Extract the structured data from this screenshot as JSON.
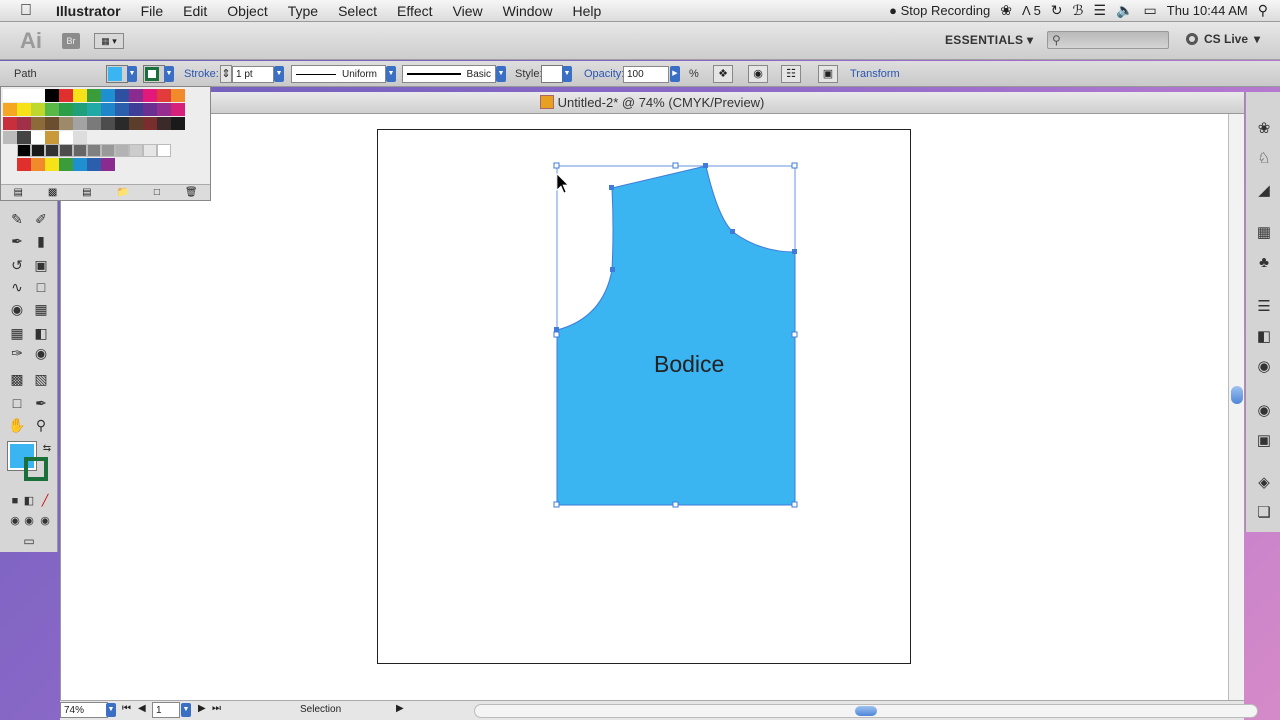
{
  "menubar": {
    "apple": "",
    "items": [
      "Illustrator",
      "File",
      "Edit",
      "Object",
      "Type",
      "Select",
      "Effect",
      "View",
      "Window",
      "Help"
    ],
    "stop_recording": "Stop Recording",
    "adobe_badge": "5",
    "clock": "Thu 10:44 AM"
  },
  "appbar": {
    "logo": "Ai",
    "bridge": "Br",
    "workspace": "ESSENTIALS",
    "cs_live": "CS Live"
  },
  "control": {
    "selection_type": "Path",
    "stroke_label": "Stroke:",
    "stroke_weight": "1 pt",
    "profile": "Uniform",
    "brush": "Basic",
    "style_label": "Style:",
    "opacity_label": "Opacity:",
    "opacity_value": "100",
    "opacity_unit": "%",
    "transform_link": "Transform"
  },
  "document": {
    "title": "Untitled-2* @ 74% (CMYK/Preview)",
    "shape_label": "Bodice",
    "fill_color": "#3bb4f2"
  },
  "status": {
    "zoom": "74%",
    "artboard_number": "1",
    "tool_name": "Selection"
  },
  "colors": {
    "fill": "#3bb4f2",
    "stroke": "#1a6f3a",
    "selection": "#3f7bd8"
  }
}
